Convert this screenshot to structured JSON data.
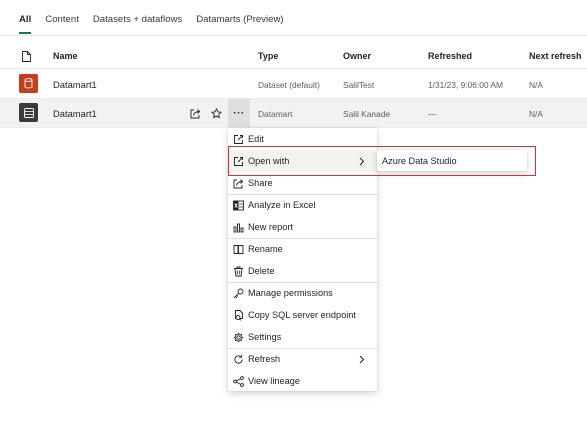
{
  "tabs": [
    {
      "label": "All",
      "active": true
    },
    {
      "label": "Content",
      "active": false
    },
    {
      "label": "Datasets + dataflows",
      "active": false
    },
    {
      "label": "Datamarts (Preview)",
      "active": false
    }
  ],
  "table": {
    "columns": {
      "name": "Name",
      "type": "Type",
      "owner": "Owner",
      "refreshed": "Refreshed",
      "next_refresh": "Next refresh"
    },
    "rows": [
      {
        "name": "Datamart1",
        "type": "Dataset (default)",
        "owner": "SalilTest",
        "refreshed": "1/31/23, 9:06:00 AM",
        "next_refresh": "N/A",
        "icon": "dataset-icon",
        "color": "#c43e1c"
      },
      {
        "name": "Datamart1",
        "type": "Datamart",
        "owner": "Salil Kanade",
        "refreshed": "—",
        "next_refresh": "N/A",
        "icon": "datamart-icon",
        "color": "#3b3a39"
      }
    ],
    "more_label": "···"
  },
  "menu": {
    "items": [
      {
        "label": "Edit",
        "icon": "edit-icon"
      },
      {
        "label": "Open with",
        "icon": "open-with-icon",
        "has_submenu": true
      },
      {
        "label": "Share",
        "icon": "share-icon"
      },
      {
        "label": "Analyze in Excel",
        "icon": "excel-icon"
      },
      {
        "label": "New report",
        "icon": "chart-icon"
      },
      {
        "label": "Rename",
        "icon": "rename-icon"
      },
      {
        "label": "Delete",
        "icon": "trash-icon"
      },
      {
        "label": "Manage permissions",
        "icon": "key-icon"
      },
      {
        "label": "Copy SQL server endpoint",
        "icon": "copy-icon"
      },
      {
        "label": "Settings",
        "icon": "gear-icon"
      },
      {
        "label": "Refresh",
        "icon": "refresh-icon",
        "has_submenu": true
      },
      {
        "label": "View lineage",
        "icon": "lineage-icon"
      }
    ],
    "submenu": {
      "label": "Azure Data Studio"
    }
  },
  "colors": {
    "accent": "#117865",
    "highlight": "#d13438",
    "dataset_icon_bg": "#c43e1c",
    "datamart_icon_bg": "#3b3a39"
  }
}
